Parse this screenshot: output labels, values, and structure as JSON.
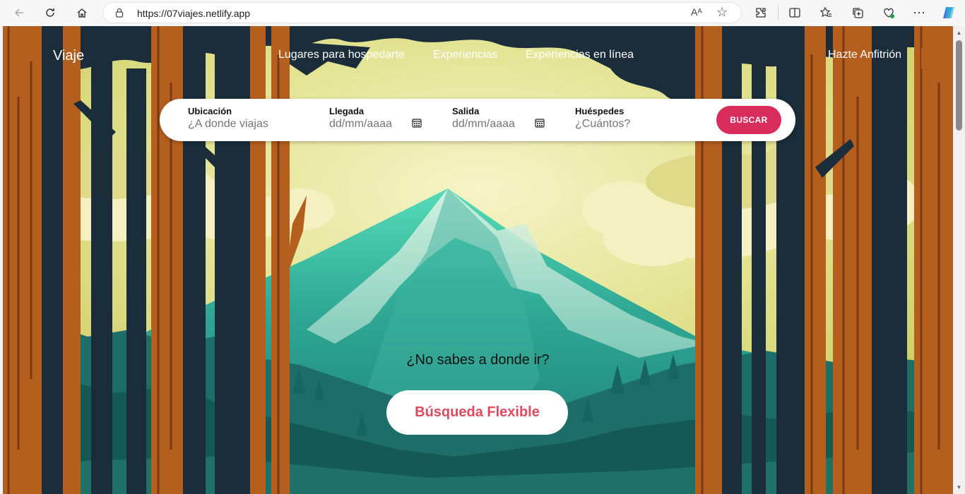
{
  "browser": {
    "url": "https://07viajes.netlify.app",
    "reader_label": "Aᴬ"
  },
  "site": {
    "logo": "Viaje",
    "nav": [
      "Lugares para hospedarte",
      "Experiencias",
      "Experiencias en línea"
    ],
    "host_link": "Hazte Anfitrión"
  },
  "search": {
    "location": {
      "label": "Ubicación",
      "placeholder": "¿A donde viajas"
    },
    "checkin": {
      "label": "Llegada",
      "placeholder": "dd/mm/aaaa"
    },
    "checkout": {
      "label": "Salida",
      "placeholder": "dd/mm/aaaa"
    },
    "guests": {
      "label": "Huéspedes",
      "placeholder": "¿Cuántos?"
    },
    "button": "BUSCAR"
  },
  "hero": {
    "question": "¿No sabes a donde ir?",
    "flex_button": "Búsqueda Flexible"
  },
  "colors": {
    "accent": "#d72c5c",
    "flex_text": "#de4a5e",
    "sky": "#d8d97a",
    "mountain": "#2a9c8a",
    "trunk_dark": "#1b2d3a",
    "trunk_orange": "#b45f1e"
  }
}
